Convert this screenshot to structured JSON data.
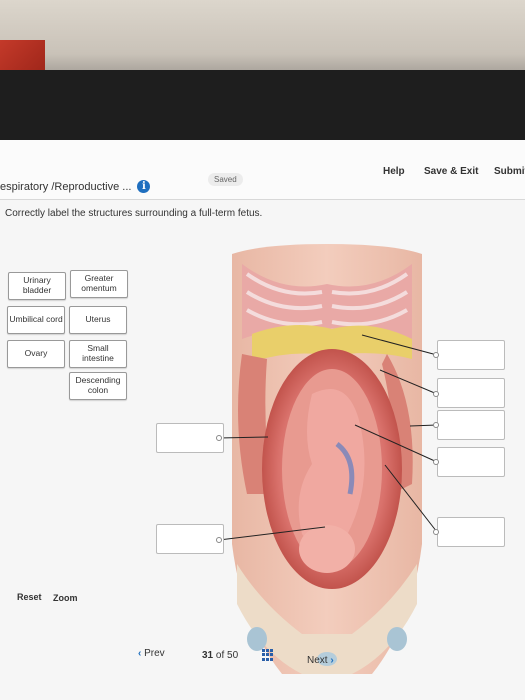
{
  "header": {
    "breadcrumb": "espiratory /Reproductive ...",
    "saved": "Saved",
    "help": "Help",
    "save_exit": "Save & Exit",
    "submit": "Submit"
  },
  "question": {
    "instruction": "Correctly label the structures surrounding a full-term fetus."
  },
  "answer_bank": [
    {
      "label": "Urinary bladder"
    },
    {
      "label": "Greater omentum"
    },
    {
      "label": "Umbilical cord"
    },
    {
      "label": "Uterus"
    },
    {
      "label": "Ovary"
    },
    {
      "label": "Small intestine"
    },
    {
      "label": "Descending colon"
    }
  ],
  "controls": {
    "reset": "Reset",
    "zoom": "Zoom"
  },
  "pagination": {
    "prev": "Prev",
    "current": "31",
    "of": "of",
    "total": "50",
    "next": "Next"
  },
  "colors": {
    "accent": "#1f6fbf",
    "text": "#333333",
    "border": "#999999"
  }
}
